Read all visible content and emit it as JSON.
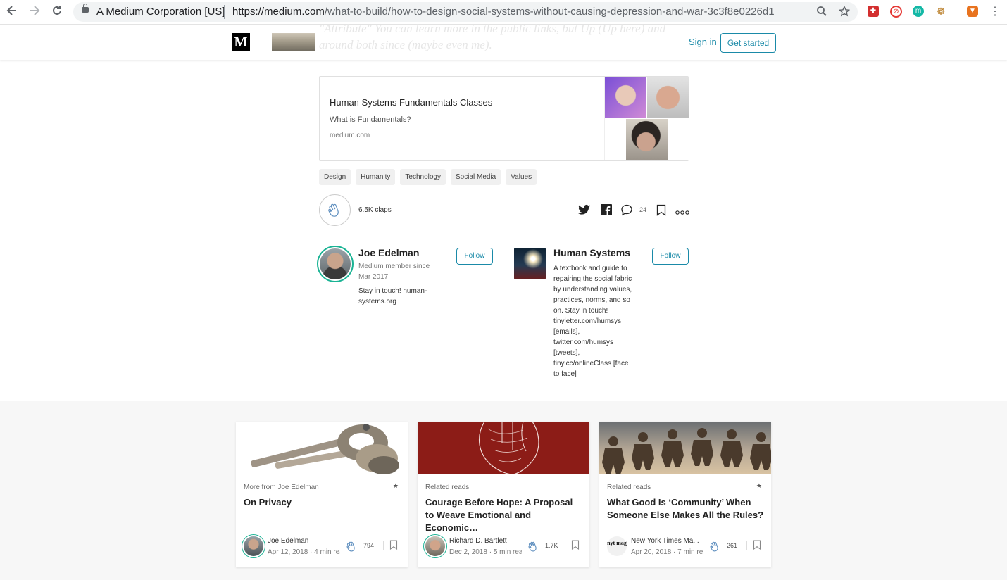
{
  "browser": {
    "site_name": "A Medium Corporation [US]",
    "url_host": "https://medium.com",
    "url_path": "/what-to-build/how-to-design-social-systems-without-causing-depression-and-war-3c3f8e0226d1"
  },
  "header": {
    "logo": "M",
    "ghost_line1": "\"Attribute\" You can learn more in the public links, but Up (Up here) and",
    "ghost_line2": "around both since (maybe even me).",
    "signin": "Sign in",
    "get_started": "Get started"
  },
  "link_card": {
    "title": "Human Systems Fundamentals Classes",
    "subtitle": "What is Fundamentals?",
    "domain": "medium.com"
  },
  "tags": [
    "Design",
    "Humanity",
    "Technology",
    "Social Media",
    "Values"
  ],
  "claps": "6.5K claps",
  "responses_count": "24",
  "author": {
    "name": "Joe Edelman",
    "meta_line1": "Medium member since",
    "meta_line2": "Mar 2017",
    "bio_line1": "Stay in touch! human-",
    "bio_line2": "systems.org",
    "follow": "Follow"
  },
  "publication": {
    "name": "Human Systems",
    "bio_lines": [
      "A textbook and guide to",
      "repairing the social fabric",
      "by understanding values,",
      "practices, norms, and so",
      "on. Stay in touch!",
      "tinyletter.com/humsys",
      "[emails],",
      "twitter.com/humsys",
      "[tweets],",
      "tiny.cc/onlineClass [face",
      "to face]"
    ],
    "follow": "Follow"
  },
  "related": [
    {
      "label": "More from Joe Edelman",
      "title": "On Privacy",
      "author": "Joe Edelman",
      "date": "Apr 12, 2018 · 4 min read",
      "claps": "794",
      "star": "★"
    },
    {
      "label": "Related reads",
      "title": "Courage Before Hope: A Proposal to Weave Emotional and Economic…",
      "author": "Richard D. Bartlett",
      "date": "Dec 2, 2018 · 5 min read",
      "claps": "1.7K",
      "star": ""
    },
    {
      "label": "Related reads",
      "title": "What Good Is ‘Community’ When Someone Else Makes All the Rules?",
      "author": "New York Times Ma...",
      "date": "Apr 20, 2018 · 7 min read",
      "claps": "261",
      "star": "★",
      "avatar_text": "nyt mag"
    }
  ],
  "colors": {
    "accent": "#1a8aa8",
    "member_ring": "#1ab394",
    "heart_red": "#8c1c17"
  }
}
